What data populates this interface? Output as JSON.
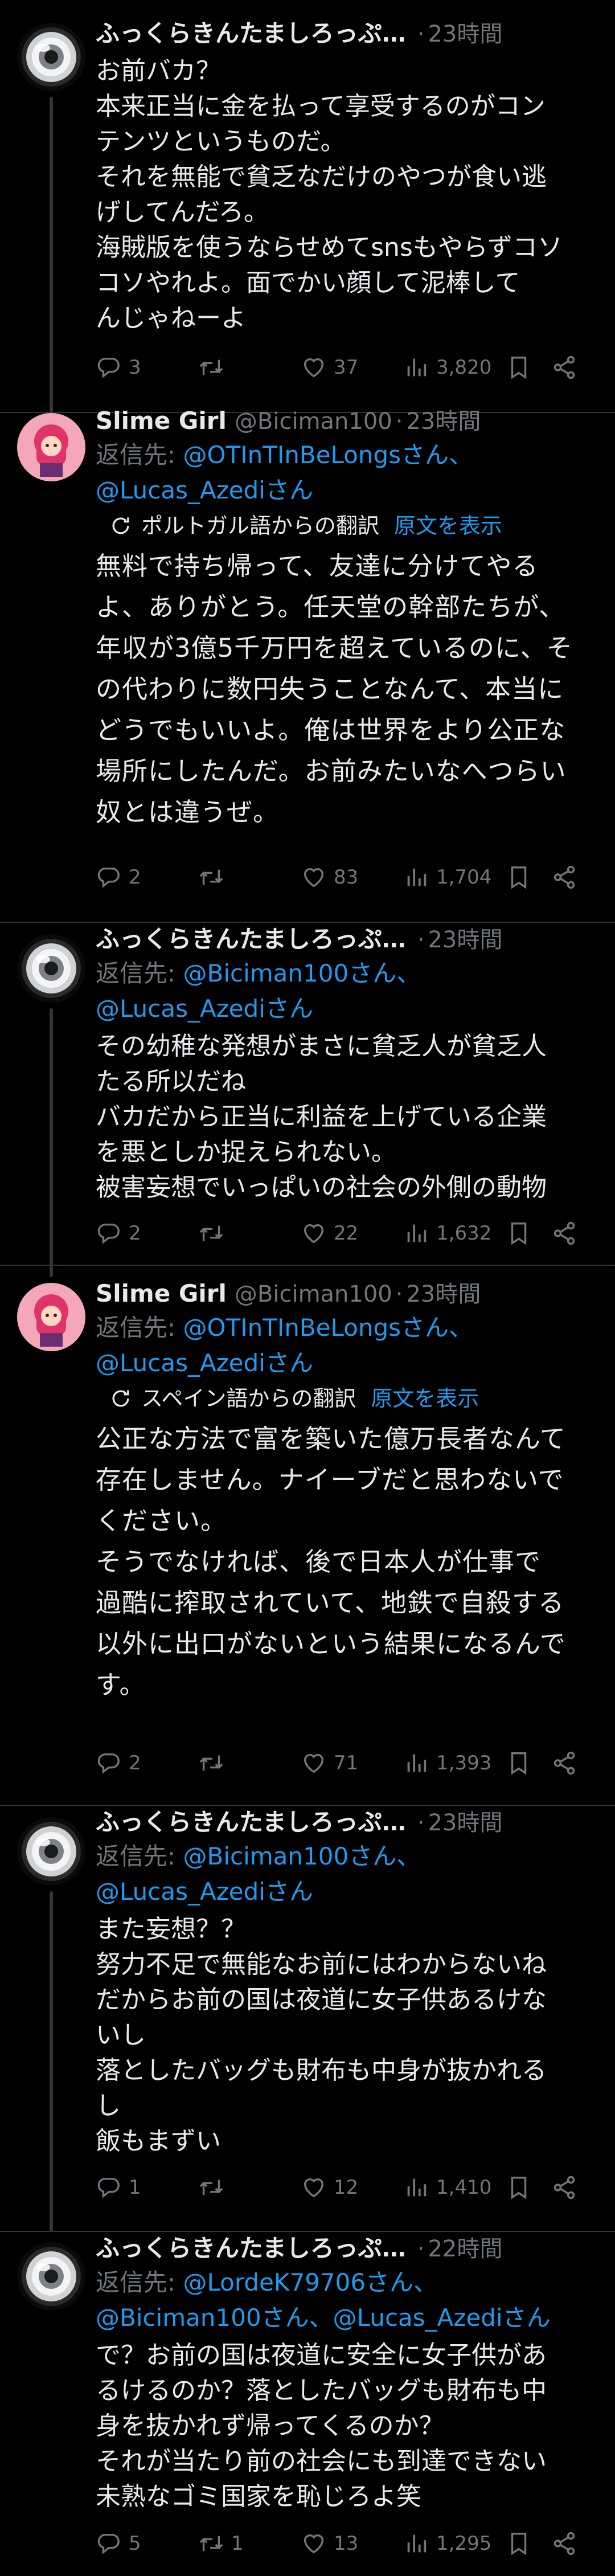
{
  "tweets": [
    {
      "name": "ふっくらきんたましろっぷ…",
      "handle": "",
      "dot": "·",
      "time": "23時間",
      "text": "お前バカ？\n本来正当に金を払って享受するのがコン\nテンツというものだ。\nそれを無能で貧乏なだけのやつが食い逃\nげしてんだろ。\n海賊版を使うならせめてsnsもやらずコソ\nコソやれよ。面でかい顔して泥棒して\nんじゃねーよ",
      "replies": "3",
      "retweets": "",
      "likes": "37",
      "views": "3,820"
    },
    {
      "name": "Slime Girl",
      "handle": "@Biciman100",
      "dot": "·",
      "time": "23時間",
      "reply_prefix": "返信先: ",
      "reply_mention1": "@OTInTInBeLongsさん、",
      "reply_mention2": "@Lucas_Azediさん",
      "translate_label": "ポルトガル語からの翻訳",
      "show_original": "原文を表示",
      "text": "無料で持ち帰って、友達に分けてやる\nよ、ありがとう。任天堂の幹部たちが、\n年収が3億5千万円を超えているのに、そ\nの代わりに数円失うことなんて、本当に\nどうでもいいよ。俺は世界をより公正な\n場所にしたんだ。お前みたいなへつらい\n奴とは違うぜ。",
      "replies": "2",
      "retweets": "",
      "likes": "83",
      "views": "1,704"
    },
    {
      "name": "ふっくらきんたましろっぷ…",
      "handle": "",
      "dot": "·",
      "time": "23時間",
      "reply_prefix": "返信先: ",
      "reply_mention1": "@Biciman100さん、",
      "reply_mention2": "@Lucas_Azediさん",
      "text": "その幼稚な発想がまさに貧乏人が貧乏人\nたる所以だね\nバカだから正当に利益を上げている企業\nを悪としか捉えられない。\n被害妄想でいっぱいの社会の外側の動物",
      "replies": "2",
      "retweets": "",
      "likes": "22",
      "views": "1,632"
    },
    {
      "name": "Slime Girl",
      "handle": "@Biciman100",
      "dot": "·",
      "time": "23時間",
      "reply_prefix": "返信先: ",
      "reply_mention1": "@OTInTInBeLongsさん、",
      "reply_mention2": "@Lucas_Azediさん",
      "translate_label": "スペイン語からの翻訳",
      "show_original": "原文を表示",
      "text": "公正な方法で富を築いた億万長者なんて\n存在しません。ナイーブだと思わないで\nください。\nそうでなければ、後で日本人が仕事で\n過酷に搾取されていて、地鉄で自殺する\n以外に出口がないという結果になるんで\nす。",
      "replies": "2",
      "retweets": "",
      "likes": "71",
      "views": "1,393"
    },
    {
      "name": "ふっくらきんたましろっぷ…",
      "handle": "",
      "dot": "·",
      "time": "23時間",
      "reply_prefix": "返信先: ",
      "reply_mention1": "@Biciman100さん、",
      "reply_mention2": "@Lucas_Azediさん",
      "text": "また妄想？？\n努力不足で無能なお前にはわからないね\nだからお前の国は夜道に女子供あるけな\nいし\n落としたバッグも財布も中身が抜かれる\nし\n飯もまずい",
      "replies": "1",
      "retweets": "",
      "likes": "12",
      "views": "1,410"
    },
    {
      "name": "ふっくらきんたましろっぷ…",
      "handle": "",
      "dot": "·",
      "time": "22時間",
      "reply_prefix": "返信先: ",
      "reply_mention1": "@LordeK79706さん、",
      "reply_mention2": "@Biciman100さん、@Lucas_Azediさん",
      "text": "で？お前の国は夜道に安全に女子供があ\nるけるのか？落としたバッグも財布も中\n身を抜かれず帰ってくるのか？\nそれが当たり前の社会にも到達できない\n未熟なゴミ国家を恥じろよ笑",
      "replies": "5",
      "retweets": "1",
      "likes": "13",
      "views": "1,295"
    }
  ]
}
